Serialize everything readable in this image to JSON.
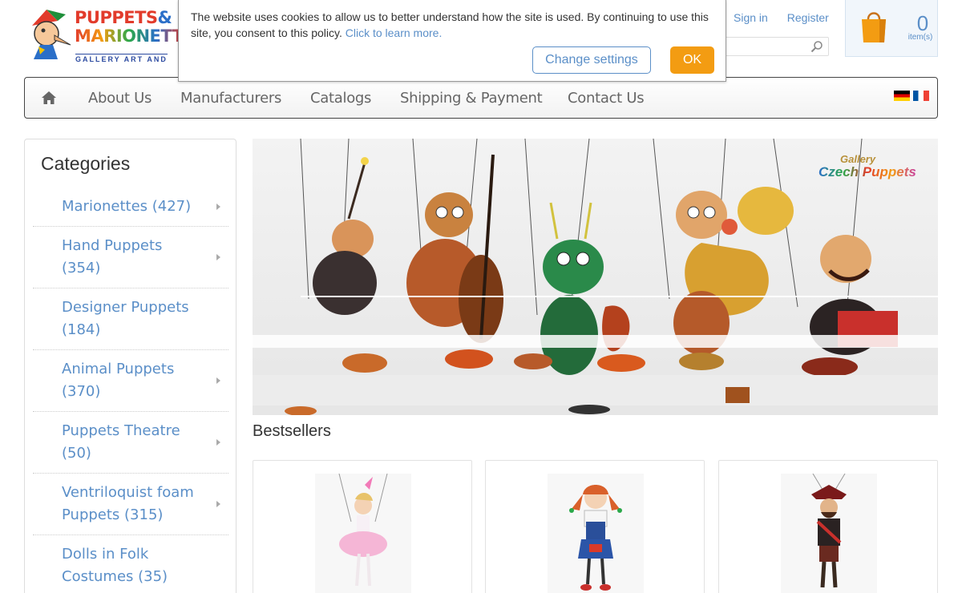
{
  "logo": {
    "line1_a": "PUPPETS",
    "line1_b": "&",
    "line2": "MARIONETT",
    "subtitle": "GALLERY ART AND"
  },
  "header": {
    "sign_in": "Sign in",
    "register": "Register",
    "search_placeholder": ""
  },
  "cart": {
    "count": "0",
    "items_label": "item(s)"
  },
  "cookie": {
    "message": "The website uses cookies to allow us to better understand how the site is used. By continuing to use this site, you consent to this policy.",
    "link": "Click to learn more.",
    "settings_button": "Change settings",
    "ok_button": "OK"
  },
  "nav": {
    "items": [
      "About Us",
      "Manufacturers",
      "Catalogs",
      "Shipping & Payment",
      "Contact Us"
    ],
    "languages": [
      "de",
      "fr"
    ]
  },
  "sidebar": {
    "title": "Categories",
    "items": [
      {
        "label": "Marionettes (427)",
        "has_arrow": true
      },
      {
        "label": "Hand Puppets (354)",
        "has_arrow": true
      },
      {
        "label": "Designer Puppets (184)",
        "has_arrow": false
      },
      {
        "label": "Animal Puppets (370)",
        "has_arrow": true
      },
      {
        "label": "Puppets Theatre (50)",
        "has_arrow": true
      },
      {
        "label": "Ventriloquist foam Puppets (315)",
        "has_arrow": true
      },
      {
        "label": "Dolls in Folk Costumes (35)",
        "has_arrow": false
      }
    ]
  },
  "banner": {
    "logo_top": "Gallery",
    "logo_bottom": "Czech Puppets"
  },
  "main": {
    "bestsellers_title": "Bestsellers"
  },
  "colors": {
    "link": "#5b8fc8",
    "ok_button": "#f39c12",
    "nav_border": "#444444"
  }
}
